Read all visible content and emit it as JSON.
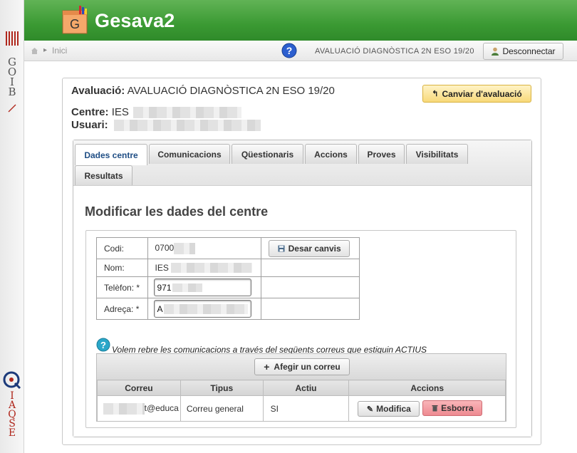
{
  "sidebar": {
    "goib_letters": [
      "G",
      "O",
      "I",
      "B"
    ],
    "iaqse_letters": [
      "I",
      "A",
      "Q",
      "S",
      "E"
    ]
  },
  "header": {
    "logo_letter": "G",
    "app_title": "Gesava2",
    "color": "#3f9d37"
  },
  "navbar": {
    "breadcrumb_home": "Inici",
    "evaluation": "AVALUACIÓ DIAGNÒSTICA 2N ESO 19/20",
    "disconnect_label": "Desconnectar"
  },
  "summary": {
    "eval_label": "Avaluació:",
    "eval_value": "AVALUACIÓ DIAGNÒSTICA 2N ESO 19/20",
    "centre_label": "Centre:",
    "centre_value": "IES",
    "user_label": "Usuari:",
    "change_eval_label": "Canviar d'avaluació"
  },
  "tabs": [
    {
      "label": "Dades centre",
      "active": true
    },
    {
      "label": "Comunicacions"
    },
    {
      "label": "Qüestionaris"
    },
    {
      "label": "Accions"
    },
    {
      "label": "Proves"
    },
    {
      "label": "Visibilitats"
    },
    {
      "label": "Resultats"
    }
  ],
  "form": {
    "title": "Modificar les dades del centre",
    "codi_label": "Codi:",
    "codi_value": "0700",
    "nom_label": "Nom:",
    "nom_value": "IES",
    "telefon_label": "Telèfon: *",
    "telefon_value": "971",
    "adreca_label": "Adreça: *",
    "adreca_value": "A",
    "discard_label": "Desar canvis"
  },
  "mails": {
    "note": "Volem rebre les comunicacions a través del següents correus que estiguin ACTIUS",
    "add_label": "Afegir un correu",
    "columns": [
      "Correu",
      "Tipus",
      "Actiu",
      "Accions"
    ],
    "rows": [
      {
        "correu": "t@educa",
        "tipus": "Correu general",
        "actiu": "SI",
        "modify": "Modifica",
        "delete": "Esborra"
      }
    ]
  },
  "colors": {
    "accent_blue": "#1f4e85",
    "delete_red": "#ee8a91",
    "highlight_yellow": "#f8d97a"
  }
}
